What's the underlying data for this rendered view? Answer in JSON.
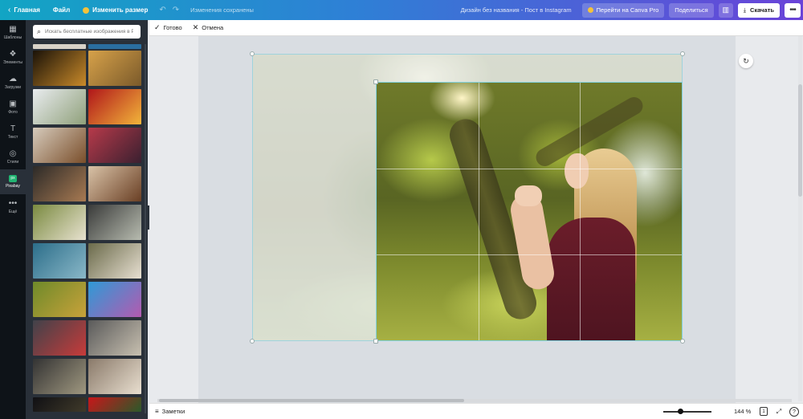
{
  "topbar": {
    "home": "Главная",
    "file": "Файл",
    "resize": "Изменить размер",
    "status": "Изменения сохранены",
    "design_title": "Дизайн без названия - Пост в Instagram",
    "canva_pro": "Перейти на Canva Pro",
    "share": "Поделиться",
    "download": "Скачать"
  },
  "rail": {
    "items": [
      {
        "label": "Шаблоны",
        "icon": "templates-icon",
        "active": false
      },
      {
        "label": "Элементы",
        "icon": "elements-icon",
        "active": false
      },
      {
        "label": "Загрузки",
        "icon": "upload-icon",
        "active": false
      },
      {
        "label": "Фото",
        "icon": "photo-icon",
        "active": false
      },
      {
        "label": "Текст",
        "icon": "text-icon",
        "active": false
      },
      {
        "label": "Стили",
        "icon": "styles-icon",
        "active": false
      },
      {
        "label": "Pixabay",
        "icon": "pixabay-icon",
        "active": true
      },
      {
        "label": "Ещё",
        "icon": "more-icon",
        "active": false
      }
    ]
  },
  "panel": {
    "search_placeholder": "Искать бесплатные изображения в P"
  },
  "thumbnails": [
    {
      "name": "lights-bokeh",
      "colors": [
        "#1a1208",
        "#c98a2a"
      ]
    },
    {
      "name": "wheat-field-road",
      "colors": [
        "#d7a24a",
        "#7b5a2a"
      ]
    },
    {
      "name": "white-blossoms",
      "colors": [
        "#e9ecef",
        "#8fa07a"
      ]
    },
    {
      "name": "red-bokeh",
      "colors": [
        "#b0161a",
        "#f2b53a"
      ]
    },
    {
      "name": "coffee-cup",
      "colors": [
        "#d6cbbc",
        "#7a4e2a"
      ]
    },
    {
      "name": "autumn-tree-red",
      "colors": [
        "#b73a4a",
        "#3a2030"
      ]
    },
    {
      "name": "hand-cup",
      "colors": [
        "#2c2a28",
        "#a87a52"
      ]
    },
    {
      "name": "open-book",
      "colors": [
        "#d9c3a8",
        "#6a3f24"
      ]
    },
    {
      "name": "reading-hands",
      "colors": [
        "#7a8a40",
        "#e8e2d0"
      ]
    },
    {
      "name": "window-sleeping",
      "colors": [
        "#3a3b3a",
        "#b8bcb0"
      ]
    },
    {
      "name": "rain-blue",
      "colors": [
        "#2c6e8a",
        "#8ab8c8"
      ]
    },
    {
      "name": "bride-dress",
      "colors": [
        "#6a6a4a",
        "#e8e0d2"
      ]
    },
    {
      "name": "girl-meadow",
      "colors": [
        "#6e8a2a",
        "#c9a23a"
      ]
    },
    {
      "name": "purple-flowers",
      "colors": [
        "#2f9ad6",
        "#b45ab0"
      ]
    },
    {
      "name": "street-girl-red",
      "colors": [
        "#40424a",
        "#c83b3a"
      ]
    },
    {
      "name": "couple-sitting",
      "colors": [
        "#5a5a5a",
        "#c8c0b0"
      ]
    },
    {
      "name": "stairs-legs",
      "colors": [
        "#333",
        "#a09880"
      ]
    },
    {
      "name": "ballet-dancer",
      "colors": [
        "#8a7a6a",
        "#e9dfd0"
      ]
    },
    {
      "name": "dark-night",
      "colors": [
        "#101014",
        "#403a2a"
      ]
    },
    {
      "name": "red-tulips",
      "colors": [
        "#c8161a",
        "#2a5a2a"
      ]
    }
  ],
  "toolbar": {
    "done": "Готово",
    "cancel": "Отмена"
  },
  "bottombar": {
    "notes": "Заметки",
    "zoom": "144 %",
    "page": "1",
    "help": "?"
  }
}
